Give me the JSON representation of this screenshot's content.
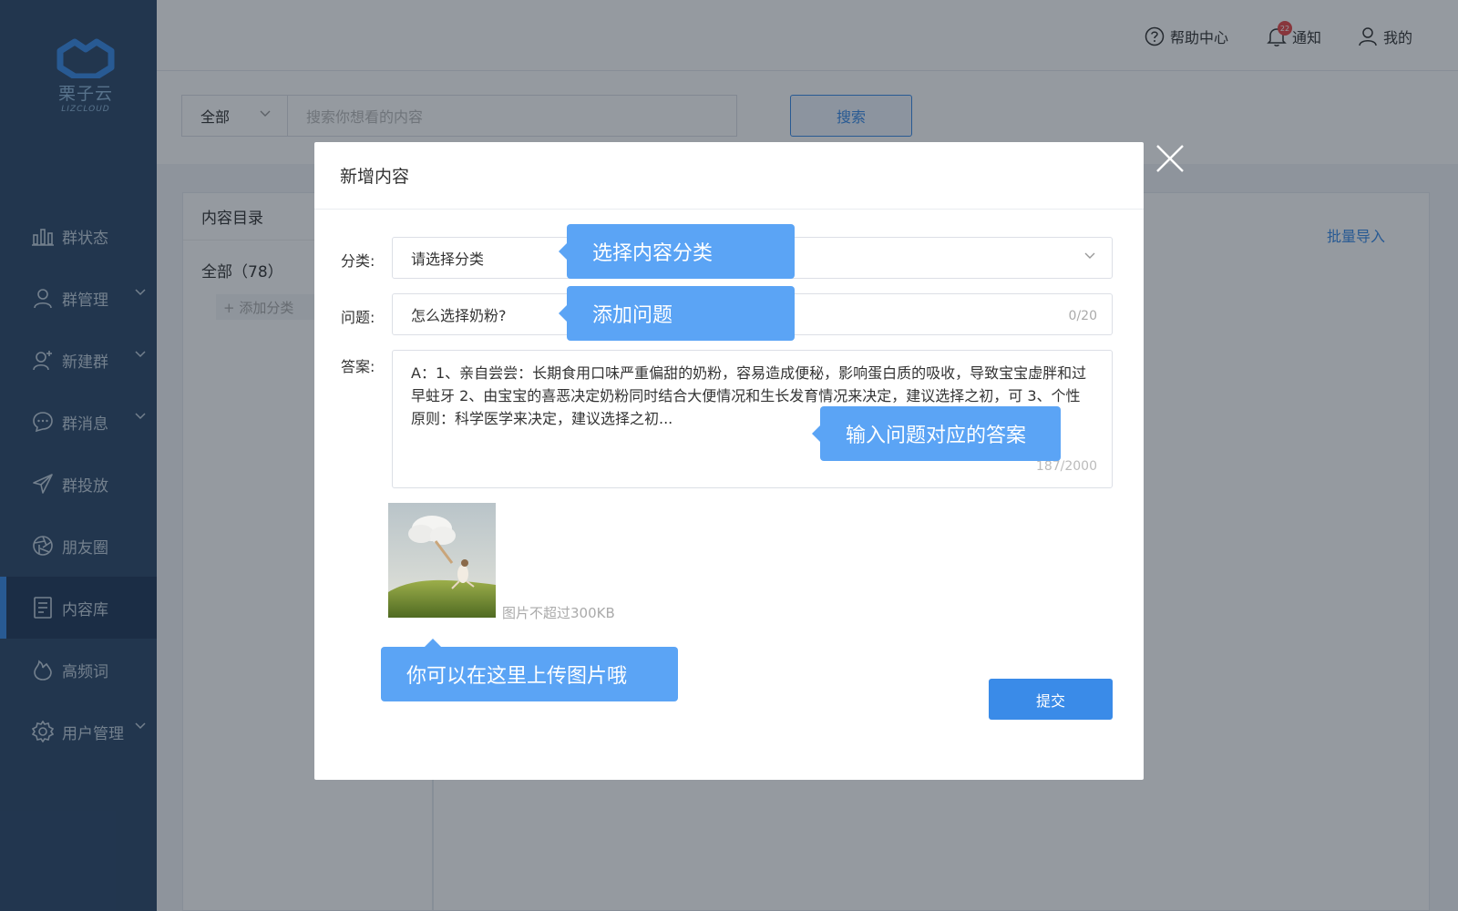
{
  "brand": {
    "name": "栗子云",
    "name_en": "LIZCLOUD"
  },
  "sidebar": {
    "items": [
      {
        "label": "群状态",
        "icon": "bar-chart-icon",
        "has_submenu": false
      },
      {
        "label": "群管理",
        "icon": "user-icon",
        "has_submenu": true
      },
      {
        "label": "新建群",
        "icon": "user-add-icon",
        "has_submenu": true
      },
      {
        "label": "群消息",
        "icon": "chat-bubble-icon",
        "has_submenu": true
      },
      {
        "label": "群投放",
        "icon": "paper-plane-icon",
        "has_submenu": false
      },
      {
        "label": "朋友圈",
        "icon": "aperture-icon",
        "has_submenu": false
      },
      {
        "label": "内容库",
        "icon": "document-icon",
        "has_submenu": false,
        "active": true
      },
      {
        "label": "高频词",
        "icon": "fire-icon",
        "has_submenu": false
      },
      {
        "label": "用户管理",
        "icon": "gear-icon",
        "has_submenu": true
      }
    ]
  },
  "header": {
    "help": "帮助中心",
    "notify": "通知",
    "notify_count": "22",
    "mine": "我的"
  },
  "search": {
    "scope": "全部",
    "placeholder": "搜索你想看的内容",
    "button": "搜索"
  },
  "catalog": {
    "title": "内容目录",
    "all": "全部（78）",
    "add": "+ 添加分类"
  },
  "batch_import": "批量导入",
  "modal": {
    "title": "新增内容",
    "category_label": "分类:",
    "category_placeholder": "请选择分类",
    "question_label": "问题:",
    "question_value": "怎么选择奶粉?",
    "question_count": "0/20",
    "answer_label": "答案:",
    "answer_value": "A：1、亲自尝尝：长期食用口味严重偏甜的奶粉，容易造成便秘，影响蛋白质的吸收，导致宝宝虚胖和过早蛀牙 2、由宝宝的喜恶决定奶粉同时结合大便情况和生长发育情况来决定，建议选择之初，可 3、个性原则：科学医学来决定，建议选择之初...",
    "answer_count": "187/2000",
    "image_hint": "图片不超过300KB",
    "submit": "提交"
  },
  "tooltips": {
    "category": "选择内容分类",
    "question": "添加问题",
    "answer": "输入问题对应的答案",
    "image": "你可以在这里上传图片哦"
  },
  "colors": {
    "accent": "#3a8be8",
    "tooltip": "#5ba4f5",
    "sidebar": "#2e4a6b",
    "badge": "#e84a4a"
  }
}
